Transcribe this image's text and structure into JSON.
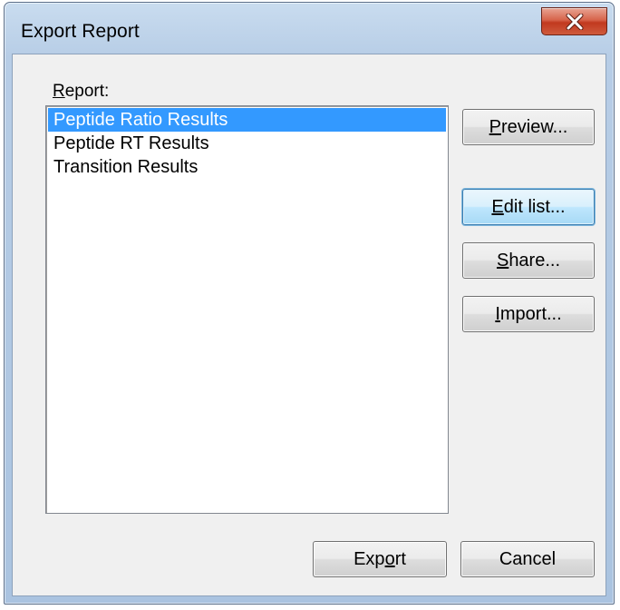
{
  "window": {
    "title": "Export Report",
    "close_icon": "close-icon"
  },
  "report": {
    "label_mnemonic": "R",
    "label_rest": "eport:",
    "items": [
      {
        "label": "Peptide Ratio Results",
        "selected": true
      },
      {
        "label": "Peptide RT Results",
        "selected": false
      },
      {
        "label": "Transition Results",
        "selected": false
      }
    ]
  },
  "buttons": {
    "preview": {
      "mnemonic": "P",
      "rest": "review..."
    },
    "edit_list": {
      "mnemonic": "E",
      "rest": "dit list..."
    },
    "share": {
      "mnemonic": "S",
      "rest": "hare..."
    },
    "import": {
      "mnemonic": "I",
      "rest": "mport..."
    },
    "export": {
      "pre": "Exp",
      "mnemonic": "o",
      "rest": "rt"
    },
    "cancel": {
      "label": "Cancel"
    }
  },
  "colors": {
    "selection": "#3399ff",
    "close_button": "#c1391f",
    "focused_button_border": "#3c7fb1"
  }
}
